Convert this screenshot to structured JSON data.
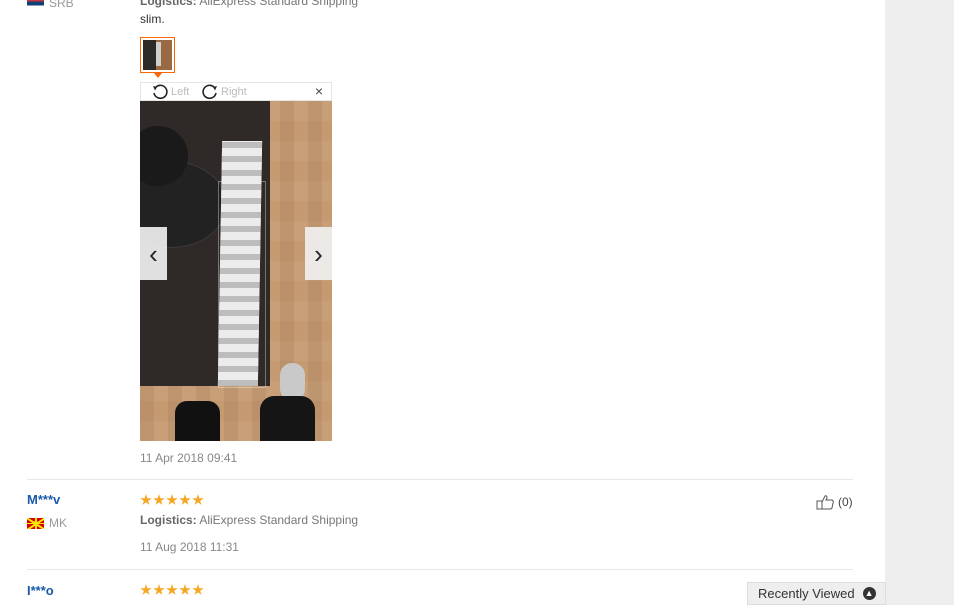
{
  "reviews": [
    {
      "country": "SRB",
      "logistics_label": "Logistics:",
      "logistics_value": "AliExpress Standard Shipping",
      "text": "slim.",
      "date": "11 Apr 2018 09:41"
    },
    {
      "user": "M***v",
      "country": "MK",
      "rating": 5,
      "logistics_label": "Logistics:",
      "logistics_value": "AliExpress Standard Shipping",
      "date": "11 Aug 2018 11:31",
      "helpful": "(0)"
    },
    {
      "user": "I***o",
      "rating": 5
    }
  ],
  "viewer": {
    "rotate_left": "Left",
    "rotate_right": "Right",
    "close": "×",
    "prev": "‹",
    "next": "›"
  },
  "recently_viewed": "Recently Viewed",
  "icons": {
    "rotate_left": "rotate-left-icon",
    "rotate_right": "rotate-right-icon",
    "thumb_up": "thumbs-up-icon",
    "chevron_up": "chevron-up-icon"
  },
  "colors": {
    "star": "#f5a623",
    "username": "#1a5aa8",
    "thumb_border": "#ff6600"
  }
}
